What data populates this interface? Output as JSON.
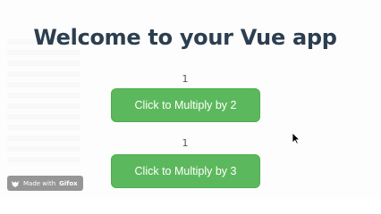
{
  "app": {
    "title": "Welcome to your Vue app"
  },
  "counters": [
    {
      "value": "1",
      "button_label": "Click to Multiply by 2"
    },
    {
      "value": "1",
      "button_label": "Click to Multiply by 3"
    }
  ],
  "watermark": {
    "prefix": "Made with",
    "brand": "Gifox"
  },
  "colors": {
    "title": "#2c3e50",
    "button_bg": "#5cb85c",
    "button_text": "#ffffff"
  },
  "icons": {
    "cursor": "mouse-pointer-icon",
    "watermark_logo": "gifox-logo-icon"
  }
}
